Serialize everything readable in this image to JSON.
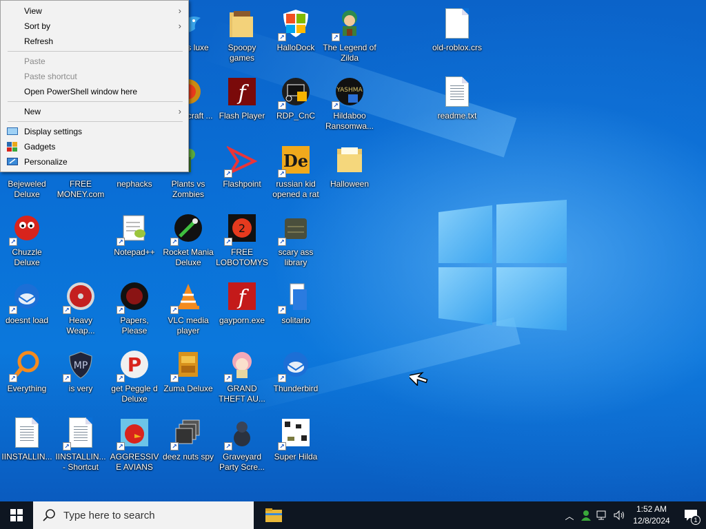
{
  "context_menu": {
    "items": [
      {
        "label": "View",
        "submenu": true,
        "disabled": false
      },
      {
        "label": "Sort by",
        "submenu": true,
        "disabled": false
      },
      {
        "label": "Refresh",
        "submenu": false,
        "disabled": false
      },
      {
        "label": "Paste",
        "submenu": false,
        "disabled": true
      },
      {
        "label": "Paste shortcut",
        "submenu": false,
        "disabled": true
      },
      {
        "label": "Open PowerShell window here",
        "submenu": false,
        "disabled": false
      },
      {
        "label": "New",
        "submenu": true,
        "disabled": false
      },
      {
        "label": "Display settings",
        "icon": "display-settings-icon",
        "disabled": false
      },
      {
        "label": "Gadgets",
        "icon": "gadgets-icon",
        "disabled": false
      },
      {
        "label": "Personalize",
        "icon": "personalize-icon",
        "disabled": false
      }
    ]
  },
  "desktop_icons": [
    {
      "label": "Nights luxe",
      "icon": "bird-game-icon",
      "shortcut": false
    },
    {
      "label": "Spoopy games",
      "icon": "folder-icon",
      "shortcut": false
    },
    {
      "label": "HalloDock",
      "icon": "windows-shield-icon",
      "shortcut": true
    },
    {
      "label": "The Legend of Zilda",
      "icon": "zelda-character-icon",
      "shortcut": true
    },
    {
      "label": "old-roblox.crs",
      "icon": "blank-file-icon",
      "shortcut": false
    },
    {
      "label": "World craft ...",
      "icon": "warcraft-icon",
      "shortcut": false
    },
    {
      "label": "Flash Player",
      "icon": "flash-player-icon",
      "shortcut": false
    },
    {
      "label": "RDP_CnC",
      "icon": "remote-desktop-icon",
      "shortcut": true
    },
    {
      "label": "Hildaboo Ransomwa...",
      "icon": "yashma-ransomware-icon",
      "shortcut": true
    },
    {
      "label": "readme.txt",
      "icon": "text-file-icon",
      "shortcut": false
    },
    {
      "label": "Bejeweled Deluxe",
      "icon": "bejeweled-icon",
      "shortcut": false
    },
    {
      "label": "FREE MONEY.com",
      "icon": "blank-icon",
      "shortcut": false
    },
    {
      "label": "nephacks",
      "icon": "blank-icon",
      "shortcut": false
    },
    {
      "label": "Plants vs Zombies",
      "icon": "plants-vs-zombies-icon",
      "shortcut": false
    },
    {
      "label": "Flashpoint",
      "icon": "flashpoint-icon",
      "shortcut": true
    },
    {
      "label": "russian kid opened a rat",
      "icon": "de-logo-icon",
      "shortcut": true
    },
    {
      "label": "Halloween",
      "icon": "folder-icon",
      "shortcut": false
    },
    {
      "label": "Chuzzle Deluxe",
      "icon": "chuzzle-icon",
      "shortcut": true
    },
    {
      "label": "Notepad++",
      "icon": "notepad-plus-plus-icon",
      "shortcut": true
    },
    {
      "label": "Rocket Mania Deluxe",
      "icon": "rocket-mania-icon",
      "shortcut": true
    },
    {
      "label": "FREE LOBOTOMYS",
      "icon": "lobotomy-icon",
      "shortcut": true
    },
    {
      "label": "scary ass library",
      "icon": "library-icon",
      "shortcut": true
    },
    {
      "label": "doesnt load",
      "icon": "thunderbird-icon",
      "shortcut": true
    },
    {
      "label": "Heavy Weap...",
      "icon": "radiation-icon",
      "shortcut": true
    },
    {
      "label": "Papers, Please",
      "icon": "papers-please-icon",
      "shortcut": true
    },
    {
      "label": "VLC media player",
      "icon": "vlc-icon",
      "shortcut": true
    },
    {
      "label": "gayporn.exe",
      "icon": "flash-player-icon",
      "shortcut": false
    },
    {
      "label": "solitario",
      "icon": "solitaire-icon",
      "shortcut": true
    },
    {
      "label": "Everything",
      "icon": "everything-search-icon",
      "shortcut": true
    },
    {
      "label": "is very",
      "icon": "shield-badge-icon",
      "shortcut": true
    },
    {
      "label": "get Peggle d Deluxe",
      "icon": "peggle-icon",
      "shortcut": true
    },
    {
      "label": "Zuma Deluxe",
      "icon": "zuma-icon",
      "shortcut": true
    },
    {
      "label": "GRAND THEFT AU...",
      "icon": "anime-girl-icon",
      "shortcut": true
    },
    {
      "label": "Thunderbird",
      "icon": "thunderbird-icon",
      "shortcut": true
    },
    {
      "label": "IINSTALLIN...",
      "icon": "text-file-icon",
      "shortcut": false
    },
    {
      "label": "IINSTALLIN... - Shortcut",
      "icon": "text-file-icon",
      "shortcut": true
    },
    {
      "label": "AGGRESSIVE AVIANS",
      "icon": "angry-birds-icon",
      "shortcut": true
    },
    {
      "label": "deez nuts spy",
      "icon": "stacked-windows-icon",
      "shortcut": true
    },
    {
      "label": "Graveyard Party Scre...",
      "icon": "graveyard-icon",
      "shortcut": true
    },
    {
      "label": "Super Hilda",
      "icon": "pixel-art-icon",
      "shortcut": true
    }
  ],
  "taskbar": {
    "search_placeholder": "Type here to search",
    "time": "1:52 AM",
    "date": "12/8/2024",
    "notification_count": "1"
  },
  "colors": {
    "desktop": "#0a6fd6",
    "taskbar": "#0e1621",
    "menu_bg": "#f2f2f2"
  }
}
